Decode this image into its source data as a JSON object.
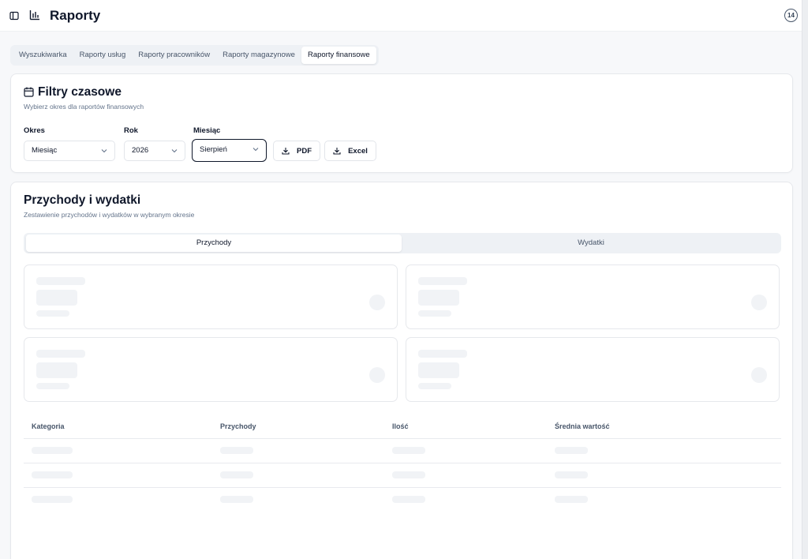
{
  "header": {
    "title": "Raporty",
    "badge": "14"
  },
  "tabs": [
    {
      "label": "Wyszukiwarka",
      "active": false
    },
    {
      "label": "Raporty usług",
      "active": false
    },
    {
      "label": "Raporty pracowników",
      "active": false
    },
    {
      "label": "Raporty magazynowe",
      "active": false
    },
    {
      "label": "Raporty finansowe",
      "active": true
    }
  ],
  "filters": {
    "title": "Filtry czasowe",
    "subtitle": "Wybierz okres dla raportów finansowych",
    "period": {
      "label": "Okres",
      "value": "Miesiąc"
    },
    "year": {
      "label": "Rok",
      "value": "2026"
    },
    "month": {
      "label": "Miesiąc",
      "value": "Sierpień"
    },
    "pdf_label": "PDF",
    "excel_label": "Excel"
  },
  "main": {
    "title": "Przychody i wydatki",
    "subtitle": "Zestawienie przychodów i wydatków w wybranym okresie",
    "segments": [
      {
        "label": "Przychody",
        "active": true
      },
      {
        "label": "Wydatki",
        "active": false
      }
    ],
    "table": {
      "columns": [
        "Kategoria",
        "Przychody",
        "Ilość",
        "Średnia wartość"
      ]
    }
  }
}
